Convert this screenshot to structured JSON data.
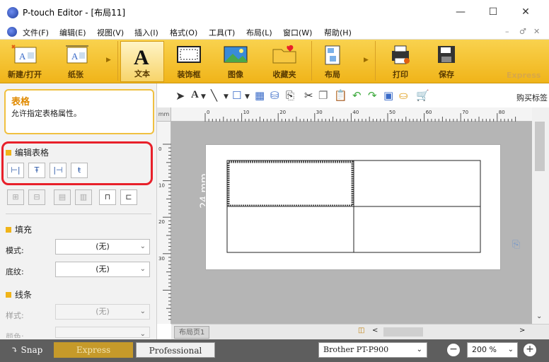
{
  "window": {
    "title": "P-touch Editor - [布局11]",
    "minimize": "—",
    "maximize": "☐",
    "close": "✕"
  },
  "menu": {
    "items": [
      "文件(F)",
      "编辑(E)",
      "视图(V)",
      "插入(I)",
      "格式(O)",
      "工具(T)",
      "布局(L)",
      "窗口(W)",
      "帮助(H)"
    ],
    "mdi_controls": [
      "–",
      "♂",
      "✕"
    ]
  },
  "ribbon": {
    "buttons": [
      {
        "label": "新建/打开",
        "icon": "new-open-icon"
      },
      {
        "label": "纸张",
        "icon": "paper-icon"
      },
      {
        "label": "文本",
        "icon": "text-icon"
      },
      {
        "label": "装饰框",
        "icon": "frame-icon"
      },
      {
        "label": "图像",
        "icon": "image-icon"
      },
      {
        "label": "收藏夹",
        "icon": "favorites-icon"
      },
      {
        "label": "布局",
        "icon": "layout-icon"
      },
      {
        "label": "打印",
        "icon": "print-icon"
      },
      {
        "label": "保存",
        "icon": "save-icon"
      }
    ],
    "express_label": "Express"
  },
  "panel": {
    "info_title": "表格",
    "info_desc": "允许指定表格属性。",
    "edit_table_header": "编辑表格",
    "fill_header": "填充",
    "mode_label": "模式:",
    "mode_value": "(无)",
    "shading_label": "底纹:",
    "shading_value": "(无)",
    "line_header": "线条",
    "style_label": "样式:",
    "style_value": "(无)",
    "color_label": "颜色:"
  },
  "toolbar": {
    "buy_label": "购买标签"
  },
  "canvas": {
    "vertical_label": "24 mm",
    "ruler_h": [
      "0",
      "10",
      "20",
      "30",
      "40",
      "50",
      "60",
      "70",
      "80"
    ],
    "ruler_v": [
      "0",
      "10",
      "20",
      "30"
    ],
    "layout_tab": "布局页1"
  },
  "status": {
    "snap": "Snap",
    "express": "Express",
    "professional": "Professional",
    "printer": "Brother PT-P900",
    "zoom": "200 %"
  },
  "colors": {
    "ribbon": "#f0b419",
    "highlight_red": "#e8202a",
    "status_bg": "#5e5e5e",
    "express_tab": "#c69a2a"
  }
}
